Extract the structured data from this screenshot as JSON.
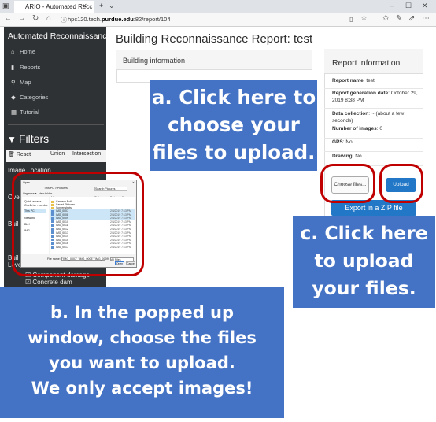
{
  "browser": {
    "tab_title": "ARIO - Automated Recc",
    "url_plain": "hpc120.tech.",
    "url_bold": "purdue.edu",
    "url_rest": ":82/report/104",
    "icons": [
      "back-arrow",
      "forward-arrow",
      "refresh-icon",
      "home-icon",
      "new-tab-plus",
      "minimize",
      "maximize",
      "close"
    ]
  },
  "sidebar": {
    "app_title": "Automated Reconnaissance Im...",
    "nav": [
      {
        "icon": "home-icon",
        "glyph": "⌂",
        "label": "Home"
      },
      {
        "icon": "file-icon",
        "glyph": "▮",
        "label": "Reports"
      },
      {
        "icon": "map-marker-icon",
        "glyph": "⚲",
        "label": "Map"
      },
      {
        "icon": "tag-icon",
        "glyph": "◆",
        "label": "Categories"
      },
      {
        "icon": "table-icon",
        "glyph": "▦",
        "label": "Tutorial"
      }
    ],
    "filters_title": "Filters",
    "filter_buttons": {
      "reset": "Reset",
      "union": "Union",
      "intersection": "Intersection"
    },
    "filter_labels": {
      "image_location": "Image Location",
      "over": "Ove",
      "build": "Buil",
      "build2": "Buil",
      "level": "Leve",
      "component": "Component damage",
      "concrete": "Concrete dam"
    }
  },
  "main": {
    "page_title": "Building Reconnaissance Report: test",
    "building_info_title": "Building information",
    "report_info": {
      "title": "Report information",
      "rows": [
        {
          "label": "Report name",
          "value": ": test"
        },
        {
          "label": "Report generation date",
          "value": ": October 29, 2019 8:38 PM"
        },
        {
          "label": "Data collection",
          "value": ": ~ (about a few seconds)"
        },
        {
          "label": "Number of images",
          "value": ": 0"
        },
        {
          "label": "GPS",
          "value": ": No"
        },
        {
          "label": "Drawing",
          "value": ": No"
        }
      ]
    },
    "choose_files_label": "Choose files...",
    "upload_label": "Upload",
    "export_label": "Export in a ZIP file"
  },
  "dialog": {
    "title": "Open",
    "breadcrumb": "This PC > Pictures",
    "search_placeholder": "Search Pictures",
    "organize": "Organize ▾",
    "new_folder": "New folder",
    "columns": [
      "Name",
      "Status",
      "Date modified"
    ],
    "tree": [
      "Quick access",
      "OneDrive - purdue",
      "This PC",
      "Network",
      "BLK",
      "IMG"
    ],
    "folders": [
      "Camera Roll",
      "Saved Pictures",
      "Screenshots"
    ],
    "files": [
      {
        "name": "IMG_0007",
        "date": "2/4/2019 7:13 PM",
        "selected": true
      },
      {
        "name": "IMG_0008",
        "date": "2/4/2019 7:13 PM",
        "selected": true
      },
      {
        "name": "IMG_0009",
        "date": "2/4/2019 7:13 PM",
        "selected": true
      },
      {
        "name": "IMG_0010",
        "date": "2/4/2019 7:13 PM",
        "selected": false
      },
      {
        "name": "IMG_0011",
        "date": "2/4/2019 7:13 PM",
        "selected": false
      },
      {
        "name": "IMG_0012",
        "date": "2/4/2019 7:13 PM",
        "selected": false
      },
      {
        "name": "IMG_0013",
        "date": "2/4/2019 7:13 PM",
        "selected": false
      },
      {
        "name": "IMG_0014",
        "date": "2/4/2019 7:13 PM",
        "selected": false
      },
      {
        "name": "IMG_0015",
        "date": "2/4/2019 7:13 PM",
        "selected": false
      },
      {
        "name": "IMG_0016",
        "date": "2/4/2019 7:13 PM",
        "selected": false
      },
      {
        "name": "IMG_0017",
        "date": "2/4/2019 7:13 PM",
        "selected": false
      }
    ],
    "filename_label": "File name:",
    "filename_value": "\"IMG_0007\" \"IMG_0008\" \"IMG_0009\"",
    "filetype": "All Files",
    "open_label": "Open",
    "cancel_label": "Cancel"
  },
  "callouts": {
    "a": [
      "a. Click here to",
      "choose your",
      "files to upload."
    ],
    "b": [
      "b. In the popped up",
      "window, choose the files",
      "you want to upload.",
      "We only accept images!"
    ],
    "c": [
      "c. Click here",
      "to upload",
      "your files."
    ]
  },
  "colors": {
    "sidebar_bg": "#2f3234",
    "callout_bg": "#4472c4",
    "highlight_red": "#c00000",
    "button_blue": "#2277c6"
  }
}
